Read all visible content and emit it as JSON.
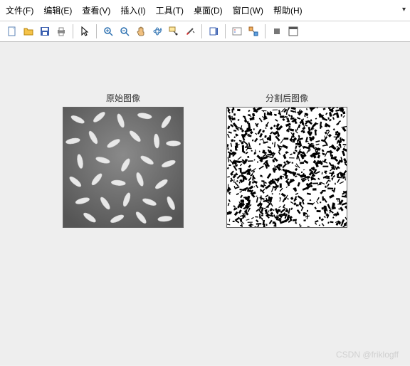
{
  "menubar": {
    "file": "文件(F)",
    "edit": "编辑(E)",
    "view": "查看(V)",
    "insert": "插入(I)",
    "tools": "工具(T)",
    "desktop": "桌面(D)",
    "window": "窗口(W)",
    "help": "帮助(H)"
  },
  "toolbar_icons": {
    "new": "new-file-icon",
    "open": "open-folder-icon",
    "save": "save-icon",
    "print": "print-icon",
    "pointer": "pointer-icon",
    "zoom_in": "zoom-in-icon",
    "zoom_out": "zoom-out-icon",
    "pan": "pan-hand-icon",
    "rotate": "rotate-3d-icon",
    "data_cursor": "data-cursor-icon",
    "brush": "brush-icon",
    "colorbar": "insert-colorbar-icon",
    "legend": "insert-legend-icon",
    "link": "link-axes-icon",
    "stop": "stop-icon",
    "dock": "dock-figure-icon"
  },
  "figure": {
    "subplot1_title": "原始图像",
    "subplot2_title": "分割后图像"
  },
  "watermark": "CSDN @friklogff"
}
